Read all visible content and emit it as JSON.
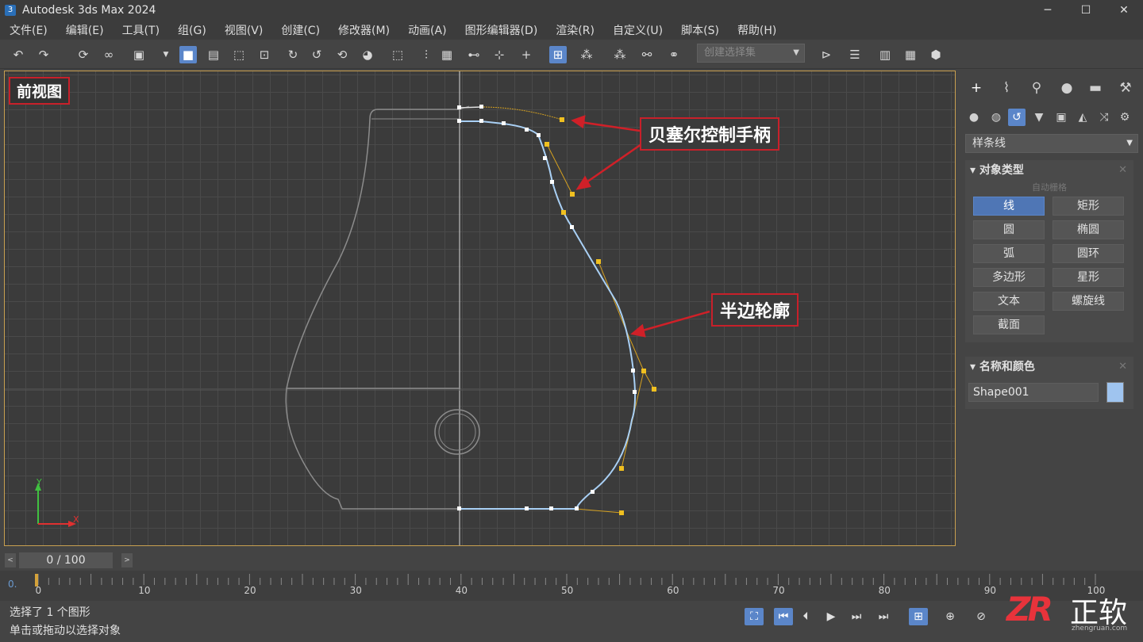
{
  "window": {
    "title": "Autodesk 3ds Max 2024",
    "logo": "3",
    "minimize": "─",
    "maximize": "☐",
    "close": "✕"
  },
  "menu": [
    "文件(E)",
    "编辑(E)",
    "工具(T)",
    "组(G)",
    "视图(V)",
    "创建(C)",
    "修改器(M)",
    "动画(A)",
    "图形编辑器(D)",
    "渲染(R)",
    "自定义(U)",
    "脚本(S)",
    "帮助(H)"
  ],
  "toolbar": {
    "selection_set_placeholder": "创建选择集"
  },
  "viewport": {
    "label": "前视图",
    "callout_handles": "贝塞尔控制手柄",
    "callout_profile": "半边轮廓",
    "axis_y": "Y",
    "axis_x": "X"
  },
  "command_panel": {
    "category_dropdown": "样条线",
    "object_type": {
      "title": "对象类型",
      "autogrid": "自动栅格",
      "buttons": [
        "线",
        "矩形",
        "圆",
        "椭圆",
        "弧",
        "圆环",
        "多边形",
        "星形",
        "文本",
        "螺旋线",
        "截面"
      ],
      "active_button": "线"
    },
    "name_color": {
      "title": "名称和颜色",
      "name": "Shape001",
      "color": "#9fc4ef"
    },
    "rollout_close": "✕"
  },
  "timeline": {
    "frame_display": "0 / 100",
    "prev_btn": "<",
    "next_btn": ">",
    "zero_label": "0.",
    "ticks": [
      "0",
      "10",
      "20",
      "30",
      "40",
      "50",
      "60",
      "70",
      "80",
      "90",
      "100"
    ]
  },
  "status": {
    "line1": "选择了 1 个图形",
    "line2": "单击或拖动以选择对象"
  },
  "watermark": {
    "logo": "ZR",
    "text": "正软",
    "url": "zhengruan.com"
  }
}
